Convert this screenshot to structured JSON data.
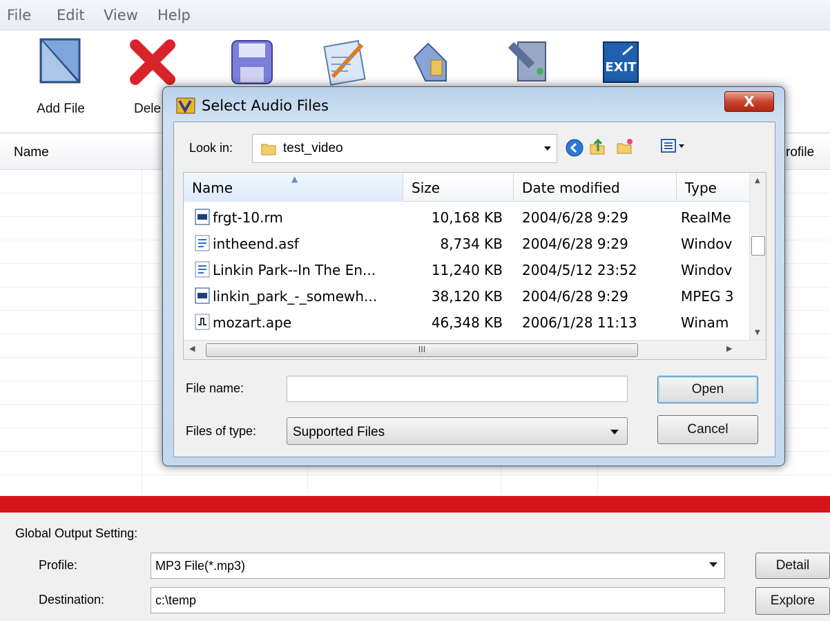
{
  "menu": [
    "File",
    "Edit",
    "View",
    "Help"
  ],
  "toolbar": {
    "add_file": "Add File",
    "delete": "Dele"
  },
  "list": {
    "col_name": "Name",
    "col_profile": "rofile"
  },
  "dialog": {
    "title": "Select Audio Files",
    "close": "X",
    "look_in_label": "Look in:",
    "look_in_value": "test_video",
    "columns": {
      "name": "Name",
      "size": "Size",
      "date": "Date modified",
      "type": "Type"
    },
    "files": [
      {
        "name": "frgt-10.rm",
        "size": "10,168 KB",
        "date": "2004/6/28 9:29",
        "type": "RealMe"
      },
      {
        "name": "intheend.asf",
        "size": "8,734 KB",
        "date": "2004/6/28 9:29",
        "type": "Windov"
      },
      {
        "name": "Linkin Park--In The En...",
        "size": "11,240 KB",
        "date": "2004/5/12 23:52",
        "type": "Windov"
      },
      {
        "name": "linkin_park_-_somewh...",
        "size": "38,120 KB",
        "date": "2004/6/28 9:29",
        "type": "MPEG 3"
      },
      {
        "name": "mozart.ape",
        "size": "46,348 KB",
        "date": "2006/1/28 11:13",
        "type": "Winam"
      }
    ],
    "hscroll_grip": "III",
    "file_name_label": "File name:",
    "file_name_value": "",
    "files_of_type_label": "Files of type:",
    "files_of_type_value": "Supported Files",
    "open": "Open",
    "cancel": "Cancel"
  },
  "bottom": {
    "section_label": "Global Output Setting:",
    "profile_label": "Profile:",
    "profile_value": "MP3 File(*.mp3)",
    "destination_label": "Destination:",
    "destination_value": "c:\\temp",
    "detail": "Detail",
    "explore": "Explore"
  },
  "colors": {
    "red_bar": "#d4161c",
    "dialog_frame": "#c4d8ee",
    "close_button": "#c8452f"
  },
  "icons": [
    "add-file-icon",
    "delete-icon",
    "save-icon",
    "edit-icon",
    "tag-icon",
    "options-icon",
    "exit-icon",
    "back-icon",
    "up-folder-icon",
    "new-folder-icon",
    "views-menu-icon"
  ]
}
